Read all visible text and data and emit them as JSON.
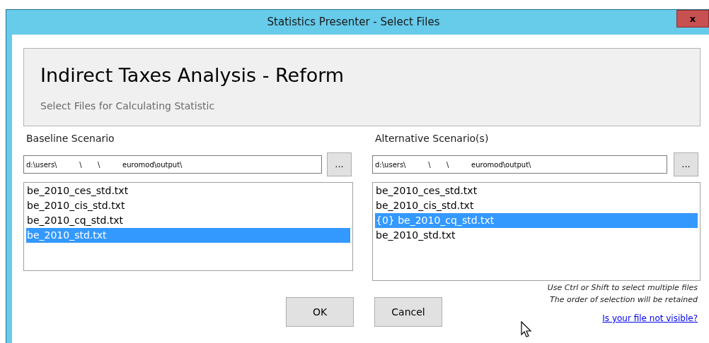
{
  "window": {
    "title": "Statistics Presenter - Select Files",
    "close": "x"
  },
  "header": {
    "title": "Indirect Taxes Analysis - Reform",
    "subtitle": "Select Files for Calculating Statistic"
  },
  "baseline": {
    "label": "Baseline Scenario",
    "path": "d:\\users\\          \\       \\          euromod\\output\\",
    "browse": "...",
    "files": [
      {
        "name": "be_2010_ces_std.txt",
        "selected": false
      },
      {
        "name": "be_2010_cis_std.txt",
        "selected": false
      },
      {
        "name": "be_2010_cq_std.txt",
        "selected": false
      },
      {
        "name": "be_2010_std.txt",
        "selected": true
      }
    ]
  },
  "alternative": {
    "label": "Alternative Scenario(s)",
    "path": "d:\\users\\          \\       \\          euromod\\output\\",
    "browse": "...",
    "files": [
      {
        "name": "be_2010_ces_std.txt",
        "selected": false
      },
      {
        "name": "be_2010_cis_std.txt",
        "selected": false
      },
      {
        "name": "{0} be_2010_cq_std.txt",
        "selected": true
      },
      {
        "name": "be_2010_std.txt",
        "selected": false
      }
    ]
  },
  "hints": [
    "Use Ctrl or Shift to select multiple files",
    "The order of selection will be retained"
  ],
  "buttons": [
    "OK",
    "Cancel"
  ],
  "link": "Is your file not visible?"
}
